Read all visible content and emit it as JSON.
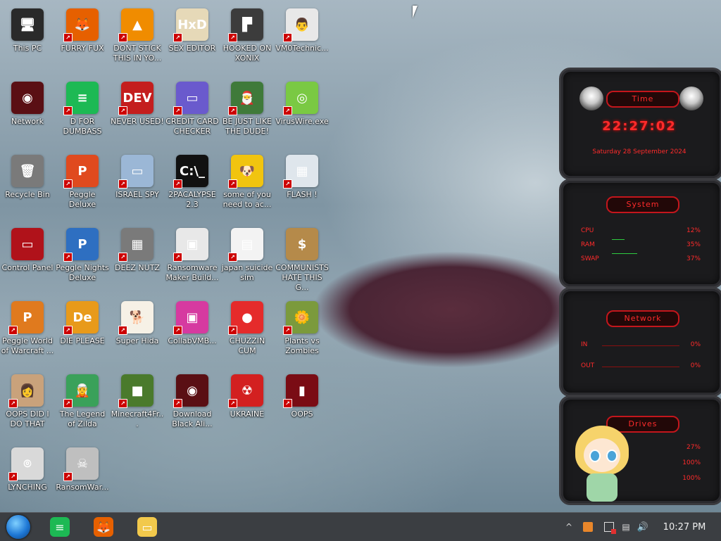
{
  "desktop": {
    "icons": [
      {
        "label": "This PC",
        "glyph": "🖥",
        "color": "#2a2a2a"
      },
      {
        "label": "FURRY FUX",
        "glyph": "🦊",
        "color": "#e66000"
      },
      {
        "label": "DONT STICK THIS IN YO...",
        "glyph": "▲",
        "color": "#f08c00"
      },
      {
        "label": "SEX EDITOR",
        "glyph": "HxD",
        "color": "#e6d9b8"
      },
      {
        "label": "HOOKED ON XONIX",
        "glyph": "▛",
        "color": "#3c3c3c"
      },
      {
        "label": "VM0Technic...",
        "glyph": "👨",
        "color": "#e8e8e8"
      },
      {
        "label": "Network",
        "glyph": "◉",
        "color": "#5a0f14"
      },
      {
        "label": "D FOR DUMBASS",
        "glyph": "≡",
        "color": "#1db954"
      },
      {
        "label": "NEVER USED!",
        "glyph": "DEV",
        "color": "#c41e1e"
      },
      {
        "label": "CREDIT CARD CHECKER",
        "glyph": "▭",
        "color": "#6a5acd"
      },
      {
        "label": "BE JUST LIKE THE DUDE!",
        "glyph": "🎅",
        "color": "#3f7a3a"
      },
      {
        "label": "VirusWire.exe",
        "glyph": "◎",
        "color": "#7ac943"
      },
      {
        "label": "Recycle Bin",
        "glyph": "🗑",
        "color": "#7a7a7a"
      },
      {
        "label": "Peggle Deluxe",
        "glyph": "P",
        "color": "#e04a1e"
      },
      {
        "label": "ISRAEL SPY",
        "glyph": "▭",
        "color": "#9bb7d6"
      },
      {
        "label": "2PACALYPSE 2.3",
        "glyph": "C:\\_",
        "color": "#111111"
      },
      {
        "label": "some of you need to ac...",
        "glyph": "🐶",
        "color": "#f1c40f"
      },
      {
        "label": "FLASH !",
        "glyph": "▦",
        "color": "#dfe6ec"
      },
      {
        "label": "Control Panel",
        "glyph": "▭",
        "color": "#b0121a"
      },
      {
        "label": "Peggle Nights Deluxe",
        "glyph": "P",
        "color": "#2e6fc1"
      },
      {
        "label": "DEEZ NUTZ",
        "glyph": "▦",
        "color": "#7a7a7a"
      },
      {
        "label": "Ransomware Maker Build...",
        "glyph": "▣",
        "color": "#e8e8e8"
      },
      {
        "label": "japan suicide sim",
        "glyph": "▤",
        "color": "#f3f3f3"
      },
      {
        "label": "COMMUNISTS HATE THIS G...",
        "glyph": "$",
        "color": "#b58a4a"
      },
      {
        "label": "Peggle World of Warcraft ...",
        "glyph": "P",
        "color": "#e07a1e"
      },
      {
        "label": "DIE PLEASE",
        "glyph": "De",
        "color": "#e89a1a"
      },
      {
        "label": "Super Hida",
        "glyph": "🐕",
        "color": "#f6f1e6"
      },
      {
        "label": "CollabVMB...",
        "glyph": "▣",
        "color": "#d63aa0"
      },
      {
        "label": "CHUZZIN CUM",
        "glyph": "●",
        "color": "#e52b2b"
      },
      {
        "label": "Plants vs Zombies",
        "glyph": "🌼",
        "color": "#7b9a3c"
      },
      {
        "label": "OOPS DID I DO THAT",
        "glyph": "👩",
        "color": "#c9a27b"
      },
      {
        "label": "The Legend of Zilda",
        "glyph": "🧝",
        "color": "#3aa15a"
      },
      {
        "label": "Minecraft4Fr...",
        "glyph": "■",
        "color": "#4a7a2c"
      },
      {
        "label": "Download Black Ali...",
        "glyph": "◉",
        "color": "#5a0f14"
      },
      {
        "label": "UKRAINE",
        "glyph": "☢",
        "color": "#d32020"
      },
      {
        "label": "OOPS",
        "glyph": "▮",
        "color": "#7a0c14"
      },
      {
        "label": "LYNCHING",
        "glyph": "⌾",
        "color": "#d9d9d9"
      },
      {
        "label": "RansomWar...",
        "glyph": "☠",
        "color": "#bfbfbf"
      }
    ]
  },
  "widget": {
    "time": {
      "title": "Time",
      "clock": "22:27:02",
      "date": "Saturday 28 September 2024"
    },
    "system": {
      "title": "System",
      "rows": [
        {
          "label": "CPU",
          "value": "12%"
        },
        {
          "label": "RAM",
          "value": "35%"
        },
        {
          "label": "SWAP",
          "value": "37%"
        }
      ]
    },
    "network": {
      "title": "Network",
      "rows": [
        {
          "label": "IN",
          "value": "0%"
        },
        {
          "label": "OUT",
          "value": "0%"
        }
      ]
    },
    "drives": {
      "title": "Drives",
      "rows": [
        {
          "label": "",
          "value": "27%"
        },
        {
          "label": "",
          "value": "100%"
        },
        {
          "label": "",
          "value": "100%"
        }
      ]
    },
    "accent": "#ff2b2b"
  },
  "taskbar": {
    "start_icon": "start-orb-icon",
    "pinned": [
      {
        "name": "notes-app-icon",
        "glyph": "≡",
        "color": "#1db954"
      },
      {
        "name": "firefox-icon",
        "glyph": "🦊",
        "color": "#e66000"
      },
      {
        "name": "file-explorer-icon",
        "glyph": "▭",
        "color": "#f2c94c"
      }
    ],
    "tray": {
      "chevron": "^",
      "clock": "10:27 PM"
    }
  }
}
